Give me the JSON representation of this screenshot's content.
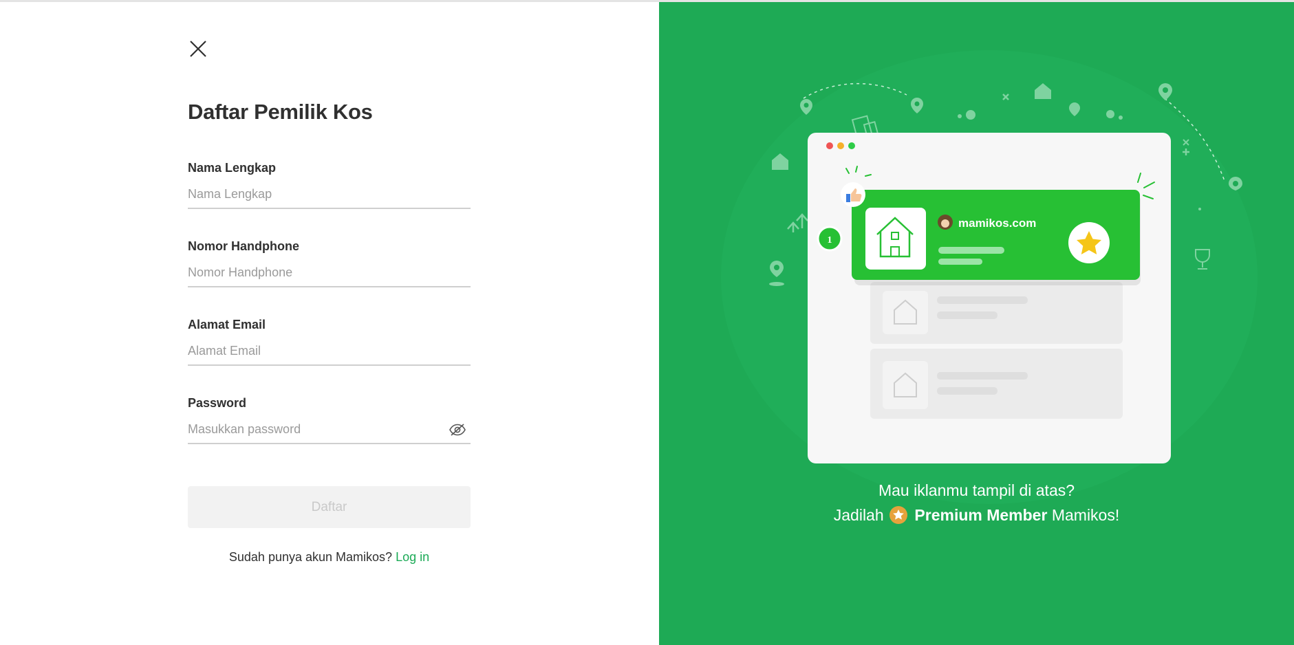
{
  "form": {
    "title": "Daftar Pemilik Kos",
    "fields": [
      {
        "label": "Nama Lengkap",
        "placeholder": "Nama Lengkap",
        "value": ""
      },
      {
        "label": "Nomor Handphone",
        "placeholder": "Nomor Handphone",
        "value": ""
      },
      {
        "label": "Alamat Email",
        "placeholder": "Alamat Email",
        "value": ""
      },
      {
        "label": "Password",
        "placeholder": "Masukkan password",
        "value": ""
      }
    ],
    "submit_label": "Daftar",
    "footer_prefix": "Sudah punya akun Mamikos?",
    "login_label": "Log in"
  },
  "promo": {
    "card_site": "mamikos.com",
    "rank_badge": "1",
    "line1": "Mau iklanmu tampil di atas?",
    "line2_prefix": "Jadilah",
    "line2_bold": "Premium Member",
    "line2_suffix": "Mamikos!"
  },
  "icons": {
    "close": "close-icon",
    "password_toggle": "eye-slash-icon",
    "premium": "star-icon"
  },
  "colors": {
    "brand_green": "#1eaa55",
    "card_green": "#27c034",
    "link_green": "#1baa56",
    "star_gold": "#f5c518",
    "badge_gold": "#e6a23c",
    "button_disabled_bg": "#f2f2f2"
  }
}
